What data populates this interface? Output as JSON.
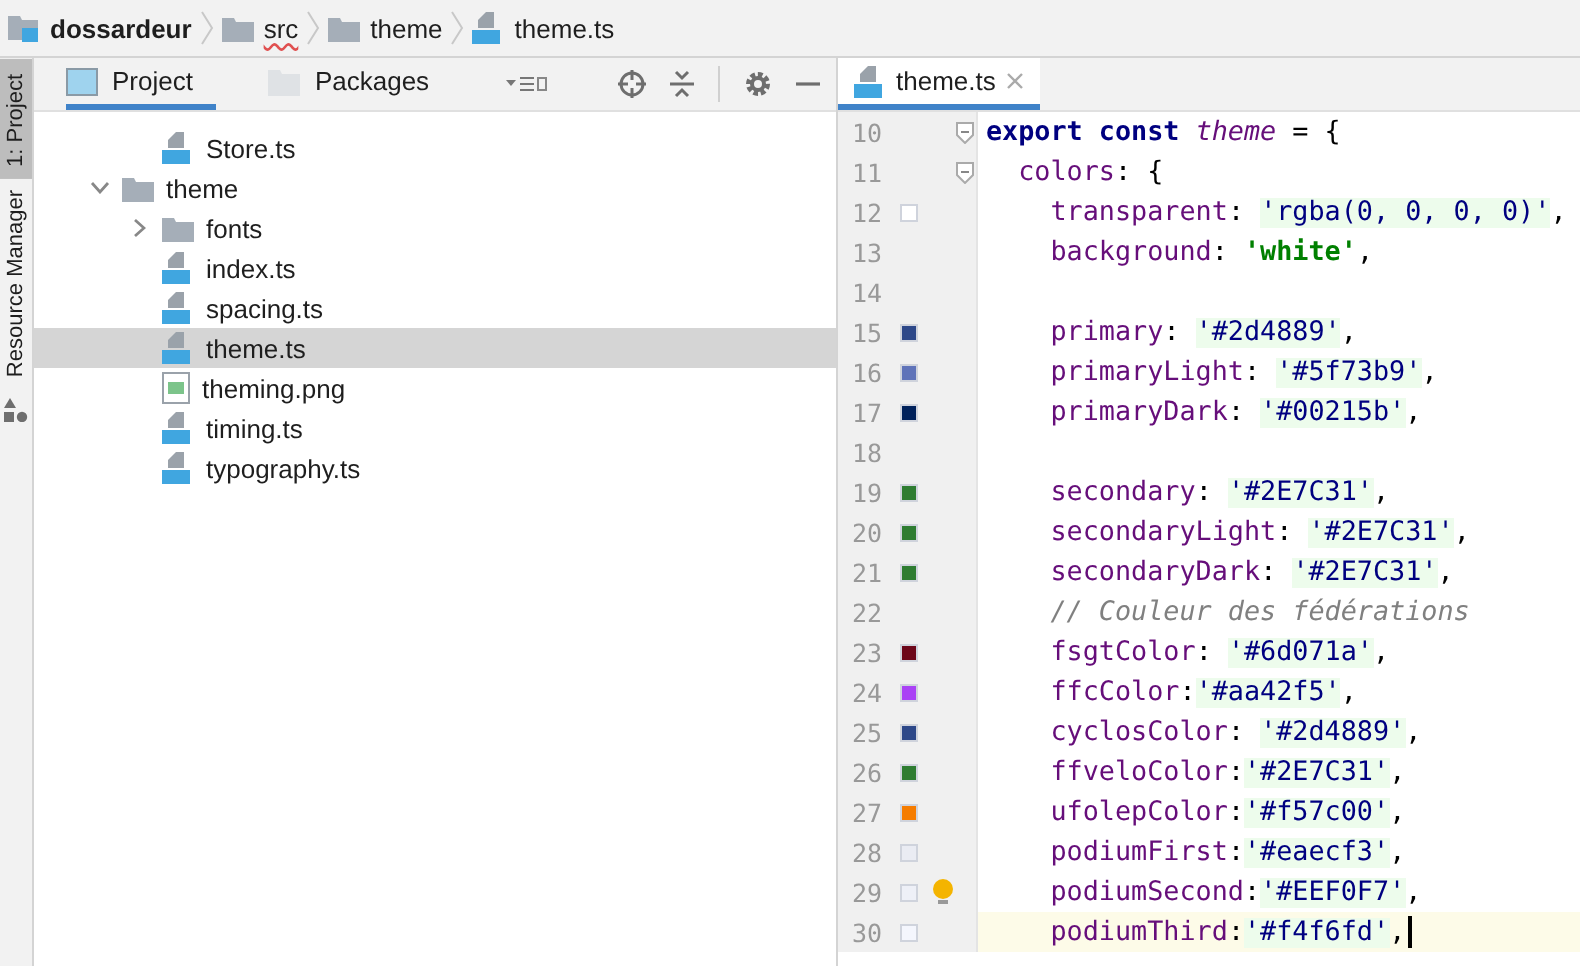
{
  "breadcrumbs": [
    {
      "label": "dossardeur",
      "kind": "module",
      "misspelled": false
    },
    {
      "label": "src",
      "kind": "folder",
      "misspelled": true
    },
    {
      "label": "theme",
      "kind": "folder",
      "misspelled": false
    },
    {
      "label": "theme.ts",
      "kind": "ts",
      "misspelled": false
    }
  ],
  "side_strip": [
    {
      "label": "1: Project",
      "selected": true
    },
    {
      "label": "Resource Manager",
      "selected": false
    }
  ],
  "project_panel": {
    "tabs": [
      {
        "label": "Project",
        "selected": true
      },
      {
        "label": "Packages",
        "selected": false
      }
    ],
    "tree": [
      {
        "children": [
          {
            "label": "Store.ts",
            "kind": "ts",
            "selected": false
          }
        ]
      },
      {
        "label": "theme",
        "kind": "folder",
        "expanded": true,
        "selected": false,
        "children": [
          {
            "label": "fonts",
            "kind": "folder",
            "expanded": false,
            "selected": false
          },
          {
            "label": "index.ts",
            "kind": "ts",
            "selected": false
          },
          {
            "label": "spacing.ts",
            "kind": "ts",
            "selected": false
          },
          {
            "label": "theme.ts",
            "kind": "ts",
            "selected": true
          },
          {
            "label": "theming.png",
            "kind": "image",
            "selected": false
          },
          {
            "label": "timing.ts",
            "kind": "ts",
            "selected": false
          },
          {
            "label": "typography.ts",
            "kind": "ts",
            "selected": false
          }
        ]
      }
    ]
  },
  "editor": {
    "tabs": [
      {
        "label": "theme.ts",
        "selected": true
      }
    ],
    "lines": [
      {
        "number": "10",
        "fold": true,
        "tokens": [
          {
            "text": "export const ",
            "kind": "keyword"
          },
          {
            "text": "theme",
            "kind": "name"
          },
          {
            "text": " = {",
            "kind": "punct"
          }
        ]
      },
      {
        "number": "11",
        "fold": true,
        "tokens": [
          {
            "text": "  colors",
            "kind": "key"
          },
          {
            "text": ": {",
            "kind": "punct"
          }
        ]
      },
      {
        "number": "12",
        "color": "#ffffff",
        "tokens": [
          {
            "text": "    transparent",
            "kind": "key"
          },
          {
            "text": ": ",
            "kind": "punct"
          },
          {
            "text": "'rgba(0, 0, 0, 0)'",
            "kind": "value"
          },
          {
            "text": ",",
            "kind": "punct"
          }
        ]
      },
      {
        "number": "13",
        "tokens": [
          {
            "text": "    background",
            "kind": "key"
          },
          {
            "text": ": ",
            "kind": "punct"
          },
          {
            "text": "'white'",
            "kind": "string"
          },
          {
            "text": ",",
            "kind": "punct"
          }
        ]
      },
      {
        "number": "14"
      },
      {
        "number": "15",
        "color": "#2d4889",
        "tokens": [
          {
            "text": "    primary",
            "kind": "key"
          },
          {
            "text": ": ",
            "kind": "punct"
          },
          {
            "text": "'#2d4889'",
            "kind": "value"
          },
          {
            "text": ",",
            "kind": "punct"
          }
        ]
      },
      {
        "number": "16",
        "color": "#5f73b9",
        "tokens": [
          {
            "text": "    primaryLight",
            "kind": "key"
          },
          {
            "text": ": ",
            "kind": "punct"
          },
          {
            "text": "'#5f73b9'",
            "kind": "value"
          },
          {
            "text": ",",
            "kind": "punct"
          }
        ]
      },
      {
        "number": "17",
        "color": "#00215b",
        "tokens": [
          {
            "text": "    primaryDark",
            "kind": "key"
          },
          {
            "text": ": ",
            "kind": "punct"
          },
          {
            "text": "'#00215b'",
            "kind": "value"
          },
          {
            "text": ",",
            "kind": "punct"
          }
        ]
      },
      {
        "number": "18"
      },
      {
        "number": "19",
        "color": "#2e7c31",
        "tokens": [
          {
            "text": "    secondary",
            "kind": "key"
          },
          {
            "text": ": ",
            "kind": "punct"
          },
          {
            "text": "'#2E7C31'",
            "kind": "value"
          },
          {
            "text": ",",
            "kind": "punct"
          }
        ]
      },
      {
        "number": "20",
        "color": "#2e7c31",
        "tokens": [
          {
            "text": "    secondaryLight",
            "kind": "key"
          },
          {
            "text": ": ",
            "kind": "punct"
          },
          {
            "text": "'#2E7C31'",
            "kind": "value"
          },
          {
            "text": ",",
            "kind": "punct"
          }
        ]
      },
      {
        "number": "21",
        "color": "#2e7c31",
        "tokens": [
          {
            "text": "    secondaryDark",
            "kind": "key"
          },
          {
            "text": ": ",
            "kind": "punct"
          },
          {
            "text": "'#2E7C31'",
            "kind": "value"
          },
          {
            "text": ",",
            "kind": "punct"
          }
        ]
      },
      {
        "number": "22",
        "tokens": [
          {
            "text": "    // Couleur des fédérations",
            "kind": "comment"
          }
        ]
      },
      {
        "number": "23",
        "color": "#6d071a",
        "tokens": [
          {
            "text": "    fsgtColor",
            "kind": "key"
          },
          {
            "text": ": ",
            "kind": "punct"
          },
          {
            "text": "'#6d071a'",
            "kind": "value"
          },
          {
            "text": ",",
            "kind": "punct"
          }
        ]
      },
      {
        "number": "24",
        "color": "#aa42f5",
        "tokens": [
          {
            "text": "    ffcColor",
            "kind": "key"
          },
          {
            "text": ":",
            "kind": "punct"
          },
          {
            "text": "'#aa42f5'",
            "kind": "value"
          },
          {
            "text": ",",
            "kind": "punct"
          }
        ]
      },
      {
        "number": "25",
        "color": "#2d4889",
        "tokens": [
          {
            "text": "    cyclosColor",
            "kind": "key"
          },
          {
            "text": ": ",
            "kind": "punct"
          },
          {
            "text": "'#2d4889'",
            "kind": "value"
          },
          {
            "text": ",",
            "kind": "punct"
          }
        ]
      },
      {
        "number": "26",
        "color": "#2e7c31",
        "tokens": [
          {
            "text": "    ffveloColor",
            "kind": "key"
          },
          {
            "text": ":",
            "kind": "punct"
          },
          {
            "text": "'#2E7C31'",
            "kind": "value"
          },
          {
            "text": ",",
            "kind": "punct"
          }
        ]
      },
      {
        "number": "27",
        "color": "#f57c00",
        "tokens": [
          {
            "text": "    ufolepColor",
            "kind": "key"
          },
          {
            "text": ":",
            "kind": "punct"
          },
          {
            "text": "'#f57c00'",
            "kind": "value"
          },
          {
            "text": ",",
            "kind": "punct"
          }
        ]
      },
      {
        "number": "28",
        "color": "#eaecf3",
        "tokens": [
          {
            "text": "    podiumFirst",
            "kind": "key"
          },
          {
            "text": ":",
            "kind": "punct"
          },
          {
            "text": "'#eaecf3'",
            "kind": "value"
          },
          {
            "text": ",",
            "kind": "punct"
          }
        ]
      },
      {
        "number": "29",
        "color": "#eef0f7",
        "hint": true,
        "tokens": [
          {
            "text": "    podiumSecond",
            "kind": "key"
          },
          {
            "text": ":",
            "kind": "punct"
          },
          {
            "text": "'#EEF0F7'",
            "kind": "value"
          },
          {
            "text": ",",
            "kind": "punct"
          }
        ]
      },
      {
        "number": "30",
        "color": "#f4f6fd",
        "current": true,
        "caret": true,
        "tokens": [
          {
            "text": "    podiumThird",
            "kind": "key"
          },
          {
            "text": ":",
            "kind": "punct"
          },
          {
            "text": "'#f4f6fd'",
            "kind": "value"
          },
          {
            "text": ",",
            "kind": "punct"
          }
        ]
      }
    ]
  }
}
